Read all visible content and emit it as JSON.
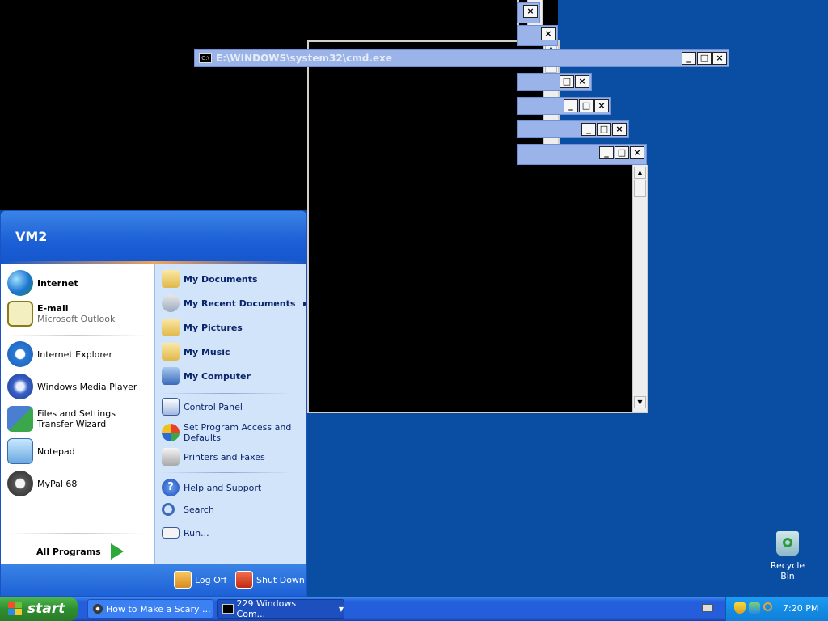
{
  "cmd_window": {
    "title": "E:\\WINDOWS\\system32\\cmd.exe",
    "icon_label": "C:\\",
    "buttons": [
      "_",
      "□",
      "×"
    ]
  },
  "start_menu": {
    "user": "VM2",
    "pinned": [
      {
        "label": "Internet",
        "icon": "internet-globe-icon"
      },
      {
        "label": "E-mail",
        "sub": "Microsoft Outlook",
        "icon": "outlook-icon"
      }
    ],
    "recent": [
      {
        "label": "Internet Explorer",
        "icon": "internet-explorer-icon"
      },
      {
        "label": "Windows Media Player",
        "icon": "media-player-icon"
      },
      {
        "label": "Files and Settings Transfer Wizard",
        "icon": "transfer-wizard-icon"
      },
      {
        "label": "Notepad",
        "icon": "notepad-icon"
      },
      {
        "label": "MyPal 68",
        "icon": "mypal-icon"
      }
    ],
    "all_programs": "All Programs",
    "right": [
      {
        "label": "My Documents",
        "bold": true
      },
      {
        "label": "My Recent Documents",
        "bold": true
      },
      {
        "label": "My Pictures",
        "bold": true
      },
      {
        "label": "My Music",
        "bold": true
      },
      {
        "label": "My Computer",
        "bold": true
      },
      {
        "label": "Control Panel"
      },
      {
        "label": "Set Program Access and Defaults"
      },
      {
        "label": "Printers and Faxes"
      },
      {
        "label": "Help and Support"
      },
      {
        "label": "Search"
      },
      {
        "label": "Run..."
      }
    ],
    "log_off": "Log Off",
    "shut_down": "Shut Down"
  },
  "desktop": {
    "recycle_bin": "Recycle Bin"
  },
  "taskbar": {
    "start": "start",
    "tasks": [
      {
        "label": "How to Make a Scary ..."
      },
      {
        "label": "229 Windows Com..."
      }
    ],
    "clock": "7:20 PM"
  }
}
